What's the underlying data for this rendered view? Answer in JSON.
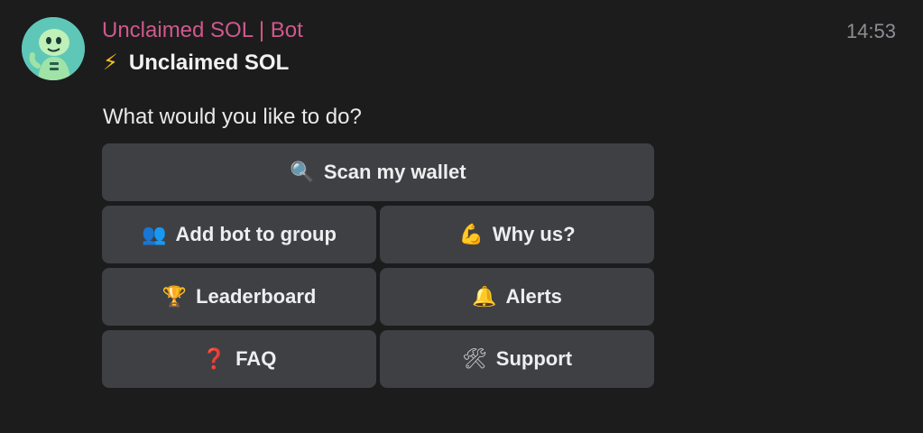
{
  "message": {
    "sender": "Unclaimed SOL | Bot",
    "time": "14:53",
    "bot_title": "Unclaimed SOL",
    "bot_title_icon": "lightning-icon",
    "prompt": "What would you like to do?"
  },
  "keyboard": {
    "buttons": [
      {
        "label": "Scan my wallet",
        "icon": "magnifier-icon"
      },
      {
        "label": "Add bot to group",
        "icon": "people-icon"
      },
      {
        "label": "Why us?",
        "icon": "flexed-biceps-icon"
      },
      {
        "label": "Leaderboard",
        "icon": "trophy-icon"
      },
      {
        "label": "Alerts",
        "icon": "bell-icon"
      },
      {
        "label": "FAQ",
        "icon": "question-mark-icon"
      },
      {
        "label": "Support",
        "icon": "hammer-wrench-icon"
      }
    ]
  },
  "colors": {
    "background": "#1c1c1d",
    "sender": "#d1588c",
    "button_bg": "#3e4044",
    "avatar_bg": "#5ec7b8"
  }
}
